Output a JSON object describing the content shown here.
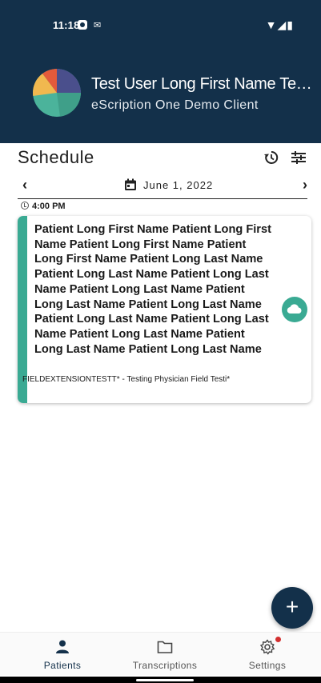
{
  "status_bar": {
    "time": "11:18",
    "notification_icons": [
      "shield-icon",
      "message-icon"
    ],
    "right_icons": [
      "wifi-icon",
      "signal-icon",
      "battery-icon"
    ]
  },
  "header": {
    "user_name": "Test User Long First Name Test Last Name",
    "client_name": "eScription One Demo Client",
    "background_color": "#13304a"
  },
  "schedule": {
    "title": "Schedule",
    "date": "June 1, 2022"
  },
  "appointments": [
    {
      "time": "4:00 PM",
      "patient_name": "Patient Long First Name Patient Long First Name Patient Long First Name Patient Long First Name Patient Long Last Name Patient Long Last Name Patient Long Last Name Patient Long Last Name Patient Long Last Name Patient Long Last Name Patient Long Last Name Patient Long Last Name Patient Long Last Name Patient Long Last Name Patient Long Last Name",
      "physician": "FIELDEXTENSIONTESTT* - Testing Physician Field Testi*",
      "accent_color": "#3aaa93",
      "status_icon": "cloud-icon"
    }
  ],
  "fab": {
    "label": "+"
  },
  "nav": {
    "items": [
      {
        "label": "Patients",
        "icon": "person-icon",
        "active": true
      },
      {
        "label": "Transcriptions",
        "icon": "folder-icon",
        "active": false
      },
      {
        "label": "Settings",
        "icon": "gear-icon",
        "active": false,
        "badge": true
      }
    ]
  }
}
